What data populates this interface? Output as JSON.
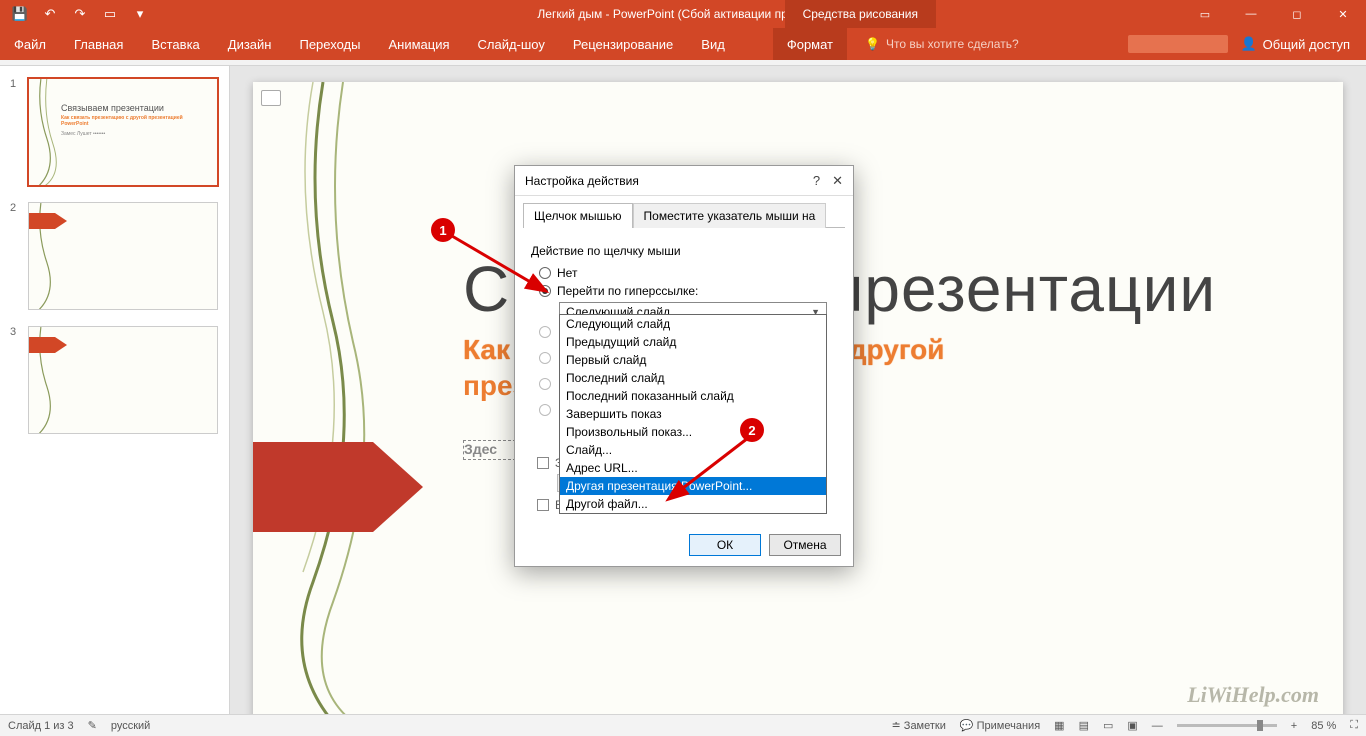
{
  "title": "Легкий дым - PowerPoint (Сбой активации продукта)",
  "context_tools_label": "Средства рисования",
  "tabs": {
    "file": "Файл",
    "home": "Главная",
    "insert": "Вставка",
    "design": "Дизайн",
    "transitions": "Переходы",
    "animations": "Анимация",
    "slideshow": "Слайд-шоу",
    "review": "Рецензирование",
    "view": "Вид",
    "format": "Формат"
  },
  "tell_me": "Что вы хотите сделать?",
  "share": "Общий доступ",
  "slide": {
    "title": "Связываем презентации",
    "sub1": "Как связать презентацию с другой",
    "sub2": "презентацией PowerPoint",
    "textbox": "Здес",
    "watermark": "LiWiHelp.com"
  },
  "thumbs": {
    "t1_title": "Связываем презентации",
    "t1_sub": "Как связать презентацию с другой презентацией PowerPoint",
    "t1_author": "Замес Лушет  •••••••"
  },
  "dialog": {
    "title": "Настройка действия",
    "help": "?",
    "close": "✕",
    "tab1": "Щелчок мышью",
    "tab2": "Поместите указатель мыши на",
    "group": "Действие по щелчку мыши",
    "opt_none": "Нет",
    "opt_hyperlink": "Перейти по гиперссылке:",
    "combo_value": "Следующий слайд",
    "opt_sound": "Звук:",
    "opt_highlight": "Выделить",
    "ok": "ОК",
    "cancel": "Отмена",
    "dd": [
      "Следующий слайд",
      "Предыдущий слайд",
      "Первый слайд",
      "Последний слайд",
      "Последний показанный слайд",
      "Завершить показ",
      "Произвольный показ...",
      "Слайд...",
      "Адрес URL...",
      "Другая презентация PowerPoint...",
      "Другой файл..."
    ]
  },
  "status": {
    "slide_of": "Слайд 1 из 3",
    "lang": "русский",
    "notes": "Заметки",
    "comments": "Примечания",
    "zoom": "85 %"
  },
  "anno": {
    "b1": "1",
    "b2": "2"
  }
}
